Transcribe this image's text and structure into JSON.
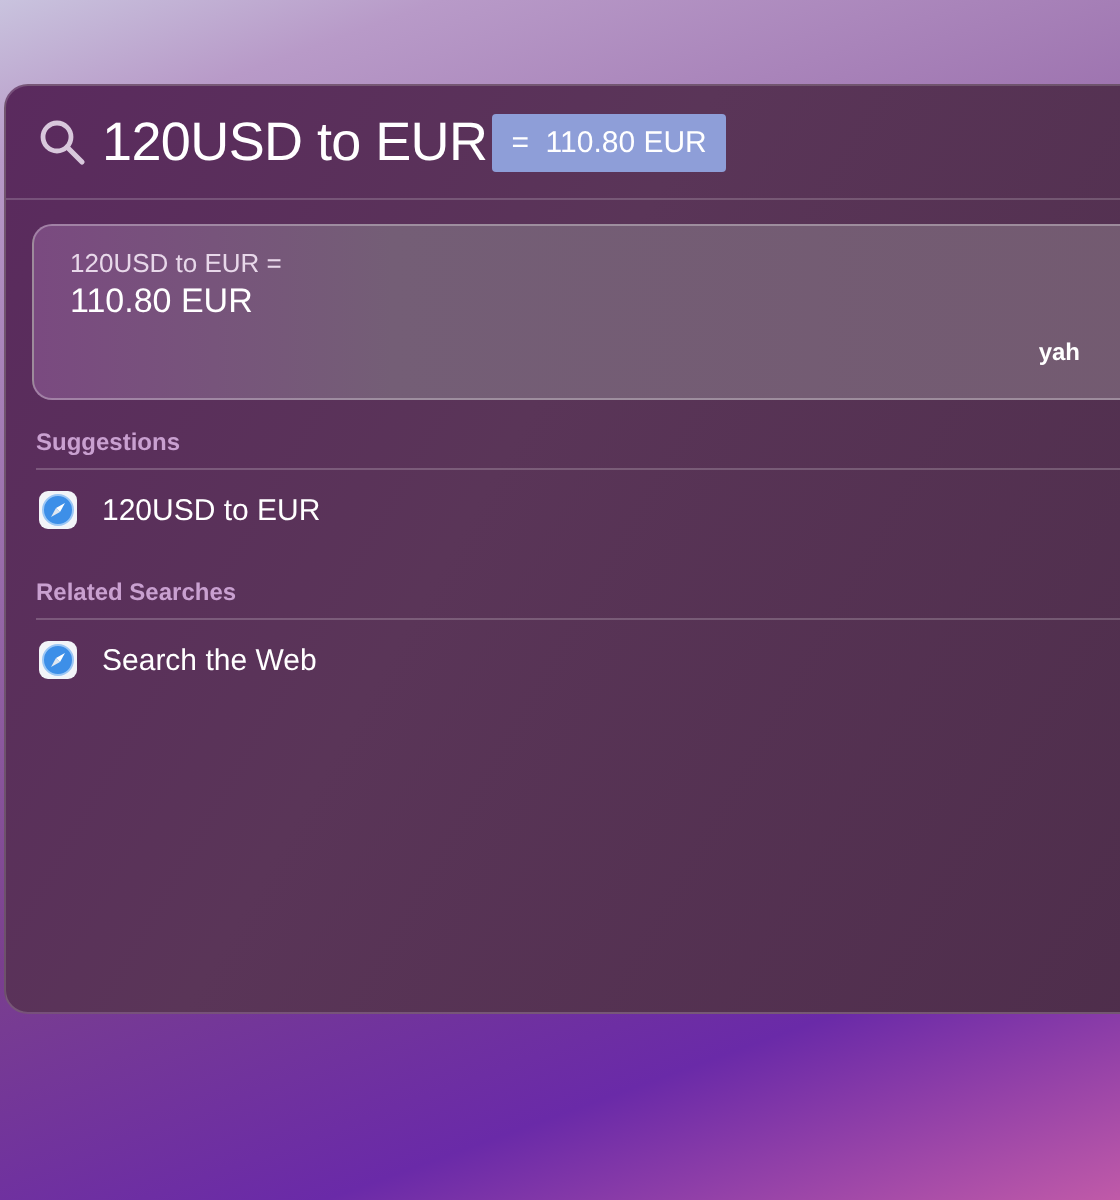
{
  "search": {
    "query": "120USD to EUR",
    "completion": "=  110.80 EUR"
  },
  "result_card": {
    "expression": "120USD to EUR =",
    "answer": "110.80 EUR",
    "source": "yah"
  },
  "sections": [
    {
      "title": "Suggestions",
      "items": [
        {
          "label": "120USD to EUR"
        }
      ]
    },
    {
      "title": "Related Searches",
      "items": [
        {
          "label": "Search the Web"
        }
      ]
    }
  ]
}
